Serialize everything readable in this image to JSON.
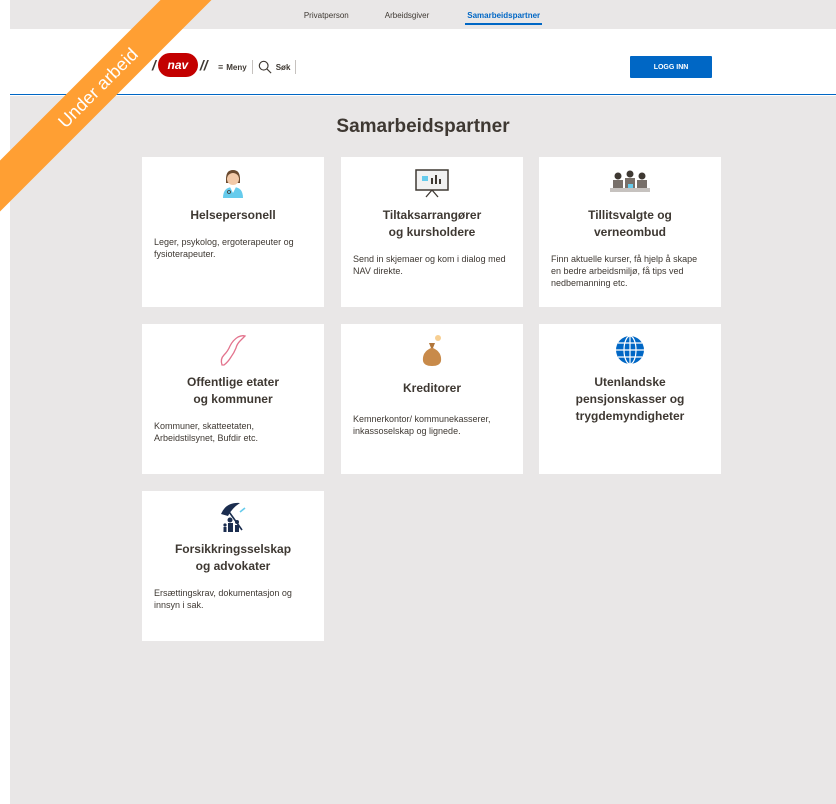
{
  "topnav": {
    "items": [
      "Privatperson",
      "Arbeidsgiver",
      "Samarbeidspartner"
    ],
    "active": "Samarbeidspartner"
  },
  "header": {
    "logo_text": "nav",
    "menu_label": "Meny",
    "search_label": "Søk",
    "login_label": "LOGG INN"
  },
  "ribbon": {
    "text": "Under arbeid"
  },
  "main": {
    "title": "Samarbeidspartner",
    "cards": [
      {
        "title_line1": "Helsepersonell",
        "title_line2": "",
        "desc": "Leger, psykolog, ergoterapeuter og fysioterapeuter.",
        "icon": "doctor-icon"
      },
      {
        "title_line1": "Tiltaksarrangører",
        "title_line2": "og kursholdere",
        "desc": "Send in skjemaer og kom i dialog med NAV direkte.",
        "icon": "presentation-icon"
      },
      {
        "title_line1": "Tillitsvalgte og",
        "title_line2": "verneombud",
        "desc": "Finn aktuelle kurser, få hjelp å skape en bedre arbeidsmiljø, få tips ved nedbemanning etc.",
        "icon": "meeting-icon"
      },
      {
        "title_line1": "Offentlige etater",
        "title_line2": "og kommuner",
        "desc": "Kommuner, skatteetaten, Arbeidstilsynet, Bufdir etc.",
        "icon": "norway-map-icon"
      },
      {
        "title_line1": "Kreditorer",
        "title_line2": "",
        "desc": "Kemnerkontor/ kommunekasserer, inkassoselskap og lignede.",
        "icon": "money-bag-icon"
      },
      {
        "title_line1": "Utenlandske",
        "title_line2": "pensjonskasser og",
        "title_line3": "trygdemyndigheter",
        "desc": "",
        "icon": "globe-icon"
      },
      {
        "title_line1": "Forsikkringsselskap",
        "title_line2": "og advokater",
        "desc": "Ersættingskrav, dokumentasjon og innsyn i sak.",
        "icon": "umbrella-family-icon"
      }
    ]
  },
  "colors": {
    "brand_red": "#c30000",
    "accent_blue": "#0067c5",
    "ribbon_orange": "#ff9f33",
    "background_gray": "#e9e7e7"
  }
}
